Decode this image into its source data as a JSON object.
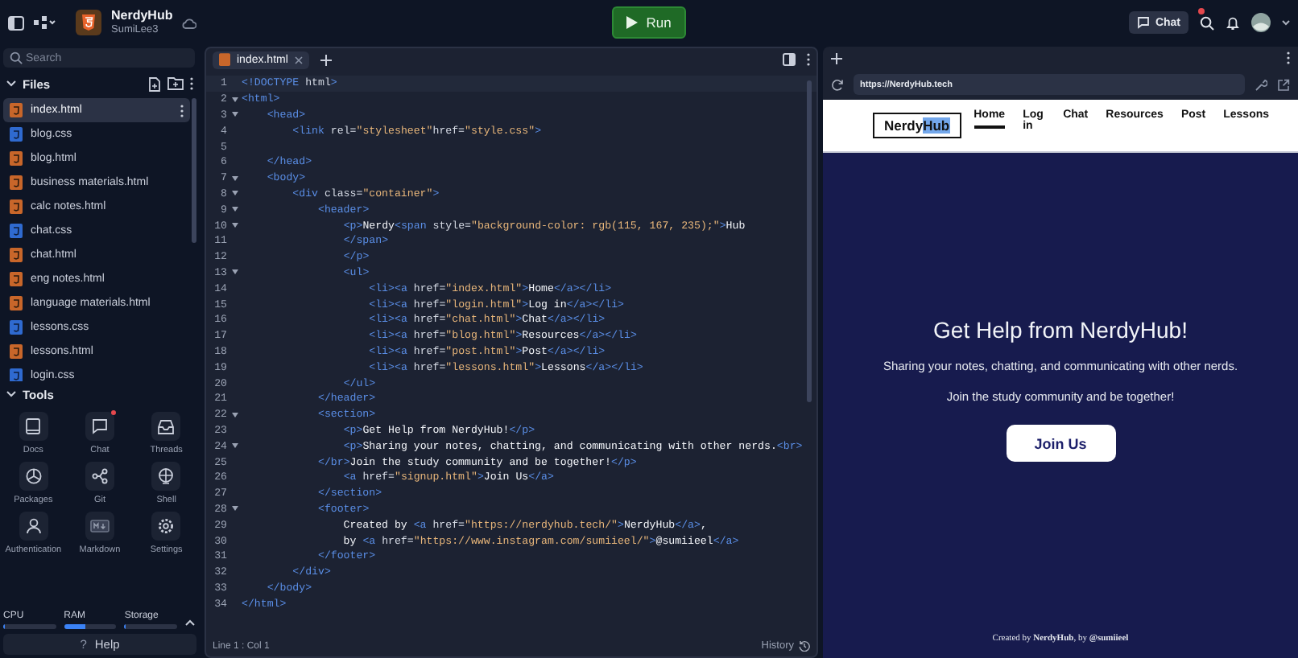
{
  "topbar": {
    "project": "NerdyHub",
    "owner": "SumiLee3",
    "run": "Run",
    "chat": "Chat",
    "chat_notification": true
  },
  "sidebar": {
    "search": {
      "placeholder": "Search"
    },
    "files_title": "Files",
    "files": [
      {
        "name": "index.html",
        "kind": "html",
        "selected": true
      },
      {
        "name": "blog.css",
        "kind": "css",
        "selected": false
      },
      {
        "name": "blog.html",
        "kind": "html",
        "selected": false
      },
      {
        "name": "business materials.html",
        "kind": "html",
        "selected": false
      },
      {
        "name": "calc notes.html",
        "kind": "html",
        "selected": false
      },
      {
        "name": "chat.css",
        "kind": "css",
        "selected": false
      },
      {
        "name": "chat.html",
        "kind": "html",
        "selected": false
      },
      {
        "name": "eng notes.html",
        "kind": "html",
        "selected": false
      },
      {
        "name": "language materials.html",
        "kind": "html",
        "selected": false
      },
      {
        "name": "lessons.css",
        "kind": "css",
        "selected": false
      },
      {
        "name": "lessons.html",
        "kind": "html",
        "selected": false
      },
      {
        "name": "login.css",
        "kind": "css",
        "selected": false
      }
    ],
    "tools_title": "Tools",
    "tools": [
      {
        "label": "Docs",
        "notification": false
      },
      {
        "label": "Chat",
        "notification": true
      },
      {
        "label": "Threads",
        "notification": false
      },
      {
        "label": "Packages",
        "notification": false
      },
      {
        "label": "Git",
        "notification": false
      },
      {
        "label": "Shell",
        "notification": false
      },
      {
        "label": "Authentication",
        "notification": false
      },
      {
        "label": "Markdown",
        "notification": false
      },
      {
        "label": "Settings",
        "notification": false
      }
    ],
    "stats": [
      {
        "label": "CPU",
        "level": 0.03
      },
      {
        "label": "RAM",
        "level": 0.4
      },
      {
        "label": "Storage",
        "level": 0.02
      }
    ],
    "help": {
      "icon": "?",
      "label": "Help"
    }
  },
  "editor": {
    "tab": "index.html",
    "lines": [
      {
        "n": "1",
        "code": "<!DOCTYPE html>",
        "fold": false
      },
      {
        "n": "2",
        "code": "<html>",
        "fold": true
      },
      {
        "n": "3",
        "code": "    <head>",
        "fold": true
      },
      {
        "n": "4",
        "code": "        <link rel=\"stylesheet\"href=\"style.css\">",
        "fold": false
      },
      {
        "n": "5",
        "fold": false
      },
      {
        "n": "6",
        "code": "    </head>",
        "fold": false
      },
      {
        "n": "7",
        "code": "    <body>",
        "fold": true
      },
      {
        "n": "8",
        "code": "        <div class=\"container\">",
        "fold": true
      },
      {
        "n": "9",
        "code": "            <header>",
        "fold": true
      },
      {
        "n": "10",
        "code": "                <p>Nerdy<span style=\"background-color: rgb(115, 167, 235);\">Hub",
        "fold": true
      },
      {
        "n": "11",
        "code": "                </span>",
        "fold": false
      },
      {
        "n": "12",
        "code": "                </p>",
        "fold": false
      },
      {
        "n": "13",
        "code": "                <ul>",
        "fold": true
      },
      {
        "n": "14",
        "code": "                    <li><a href=\"index.html\">Home</a></li>",
        "fold": false
      },
      {
        "n": "15",
        "code": "                    <li><a href=\"login.html\">Log in</a></li>",
        "fold": false
      },
      {
        "n": "16",
        "code": "                    <li><a href=\"chat.html\">Chat</a></li>",
        "fold": false
      },
      {
        "n": "17",
        "code": "                    <li><a href=\"blog.html\">Resources</a></li>",
        "fold": false
      },
      {
        "n": "18",
        "code": "                    <li><a href=\"post.html\">Post</a></li>",
        "fold": false
      },
      {
        "n": "19",
        "code": "                    <li><a href=\"lessons.html\">Lessons</a></li>",
        "fold": false
      },
      {
        "n": "20",
        "code": "                </ul>",
        "fold": false
      },
      {
        "n": "21",
        "code": "            </header>",
        "fold": false
      },
      {
        "n": "22",
        "code": "            <section>",
        "fold": true
      },
      {
        "n": "23",
        "code": "                <p>Get Help from NerdyHub!</p>",
        "fold": false
      },
      {
        "n": "24",
        "code": "                <p>Sharing your notes, chatting, and communicating with other nerds.<br>",
        "fold": true
      },
      {
        "n": "25",
        "code": "            </br>Join the study community and be together!</p>",
        "fold": false
      },
      {
        "n": "26",
        "code": "                <a href=\"signup.html\">Join Us</a>",
        "fold": false
      },
      {
        "n": "27",
        "code": "            </section>",
        "fold": false
      },
      {
        "n": "28",
        "code": "            <footer>",
        "fold": true
      },
      {
        "n": "29",
        "code": "                Created by <a href=\"https://nerdyhub.tech/\">NerdyHub</a>,",
        "fold": false
      },
      {
        "n": "30",
        "code": "                by <a href=\"https://www.instagram.com/sumiieel/\">@sumiieel</a>",
        "fold": false
      },
      {
        "n": "31",
        "code": "            </footer>",
        "fold": false
      },
      {
        "n": "32",
        "code": "        </div>",
        "fold": false
      },
      {
        "n": "33",
        "code": "    </body>",
        "fold": false
      },
      {
        "n": "34",
        "code": "</html>",
        "fold": false
      }
    ],
    "status": "Line 1 : Col 1",
    "history": "History"
  },
  "preview": {
    "url": "https://NerdyHub.tech",
    "logo": {
      "text": "Nerdy",
      "highlight": "Hub"
    },
    "nav": [
      {
        "label": "Home",
        "selected": true
      },
      {
        "label": "Log in",
        "selected": false
      },
      {
        "label": "Chat",
        "selected": false
      },
      {
        "label": "Resources",
        "selected": false
      },
      {
        "label": "Post",
        "selected": false
      },
      {
        "label": "Lessons",
        "selected": false
      }
    ],
    "heading": "Get Help from NerdyHub!",
    "paragraphs": [
      "Sharing your notes, chatting, and communicating with other nerds.",
      "Join the study community and be together!"
    ],
    "button": "Join Us",
    "footer": "Created by **NerdyHub**, by **@sumiieel**"
  }
}
